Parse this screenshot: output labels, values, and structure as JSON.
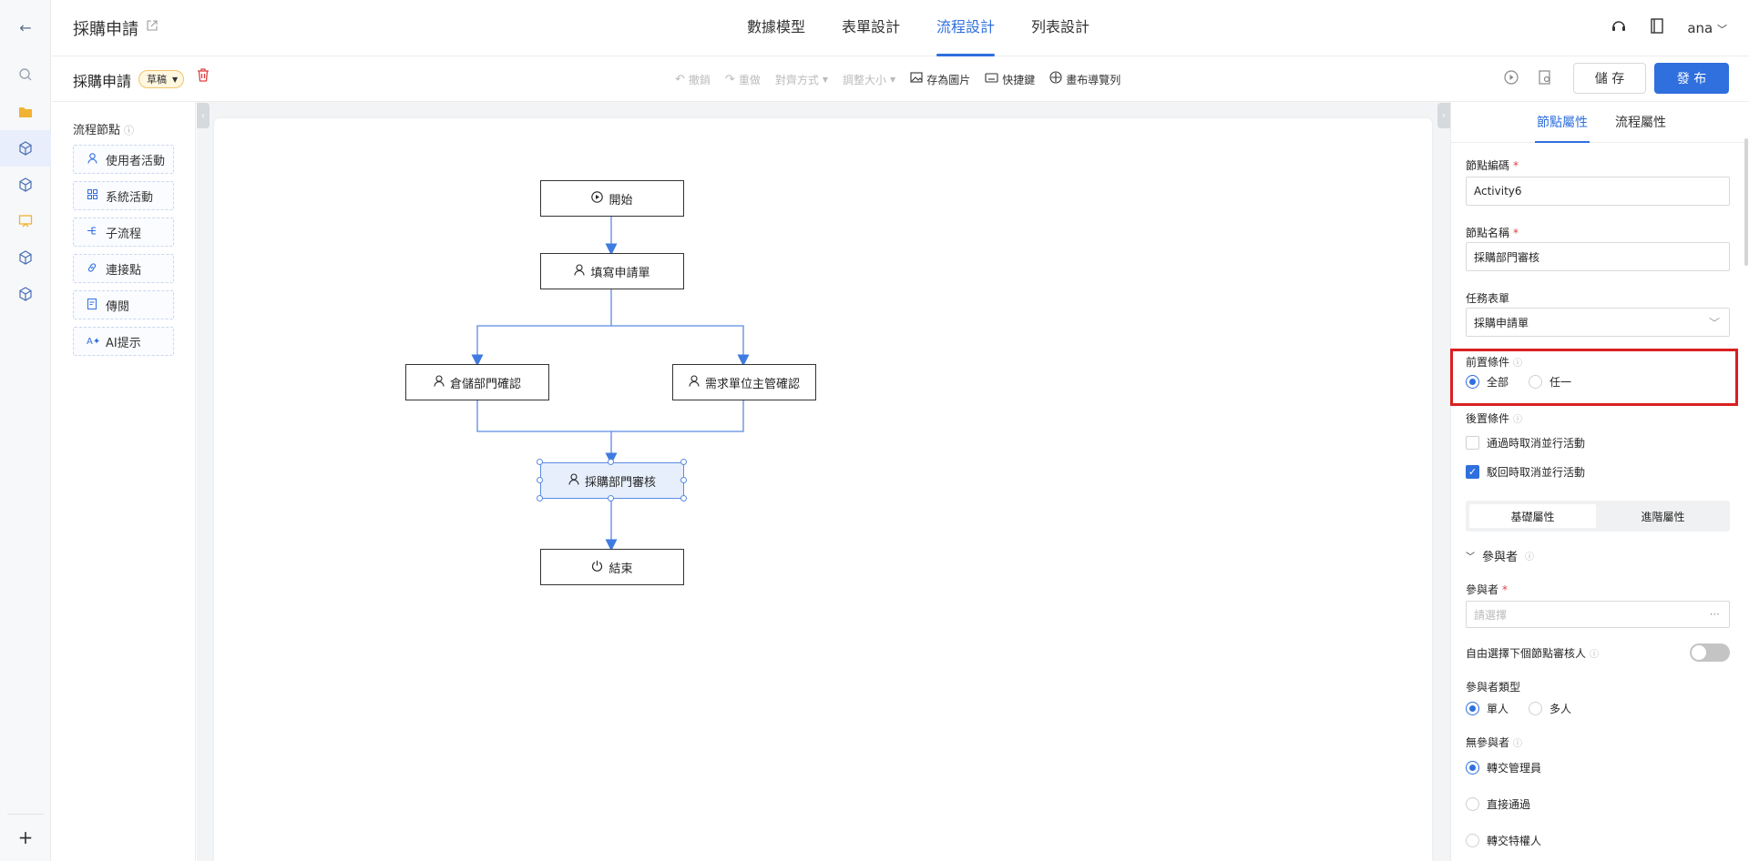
{
  "app": {
    "title": "採購申請"
  },
  "tabs": [
    "數據模型",
    "表單設計",
    "流程設計",
    "列表設計"
  ],
  "user": {
    "name": "ana"
  },
  "toolbar": {
    "doc_title": "採購申請",
    "status": "草稿",
    "tools": [
      "撤銷",
      "重做",
      "對齊方式",
      "調整大小",
      "存為圖片",
      "快捷鍵",
      "畫布導覽列"
    ],
    "save_label": "儲 存",
    "publish_label": "發 布"
  },
  "nodes_panel": {
    "title": "流程節點",
    "items": [
      "使用者活動",
      "系統活動",
      "子流程",
      "連接點",
      "傳閱",
      "AI提示"
    ]
  },
  "flow": {
    "nodes": [
      "開始",
      "填寫申請單",
      "倉儲部門確認",
      "需求單位主管確認",
      "採購部門審核",
      "結束"
    ]
  },
  "props": {
    "tabs": [
      "節點屬性",
      "流程屬性"
    ],
    "code_label": "節點編碼",
    "code_value": "Activity6",
    "name_label": "節點名稱",
    "name_value": "採購部門審核",
    "form_label": "任務表單",
    "form_value": "採購申請單",
    "pre_label": "前置條件",
    "pre_options": [
      "全部",
      "任一"
    ],
    "post_label": "後置條件",
    "post_options": [
      "通過時取消並行活動",
      "駁回時取消並行活動"
    ],
    "seg": [
      "基礎屬性",
      "進階屬性"
    ],
    "participants_section": "參與者",
    "participant_label": "參與者",
    "participant_placeholder": "請選擇",
    "free_select_label": "自由選擇下個節點審核人",
    "ptype_label": "參與者類型",
    "ptype_options": [
      "單人",
      "多人"
    ],
    "none_label": "無參與者",
    "none_options": [
      "轉交管理員",
      "直接通過",
      "轉交特權人"
    ]
  }
}
